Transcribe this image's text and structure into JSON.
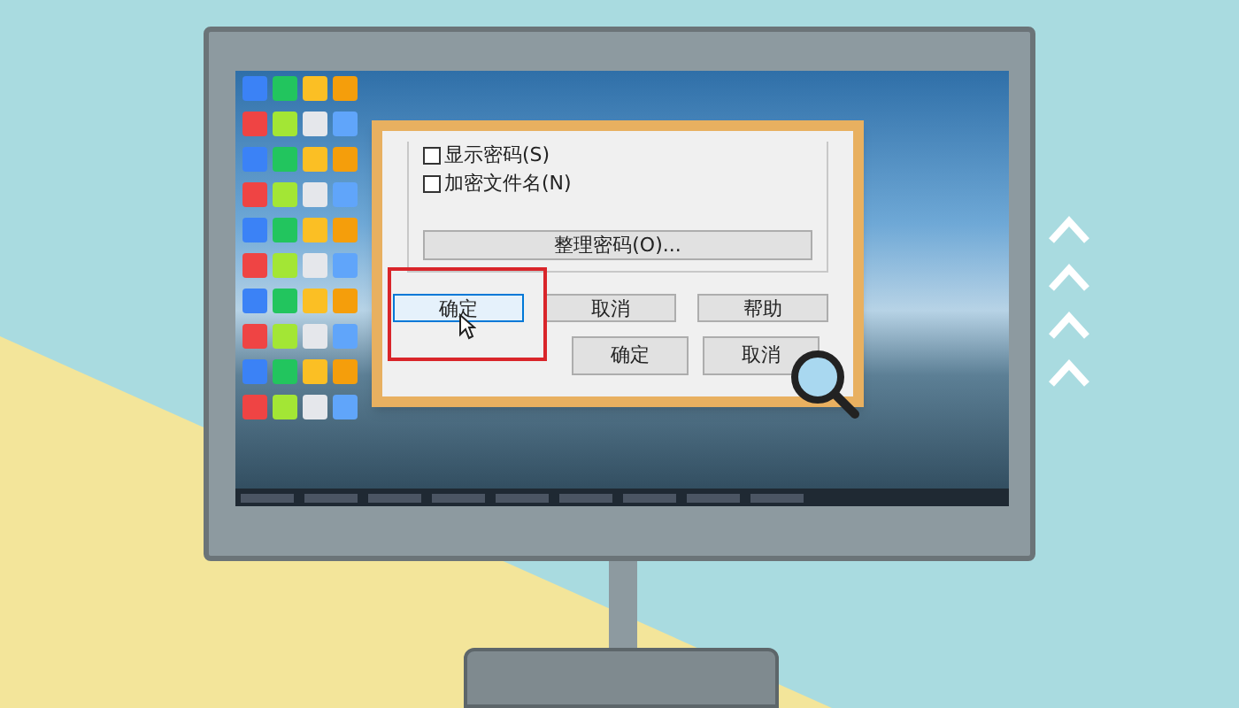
{
  "zoom_panel": {
    "checkboxes": [
      {
        "label": "显示密码(S)",
        "checked": false
      },
      {
        "label": "加密文件名(N)",
        "checked": false
      }
    ],
    "manage_button": "整理密码(O)...",
    "buttons": [
      {
        "label": "确定",
        "selected": true
      },
      {
        "label": "取消",
        "selected": false
      },
      {
        "label": "帮助",
        "selected": false
      }
    ],
    "footer_buttons": [
      "确定",
      "取消"
    ]
  }
}
